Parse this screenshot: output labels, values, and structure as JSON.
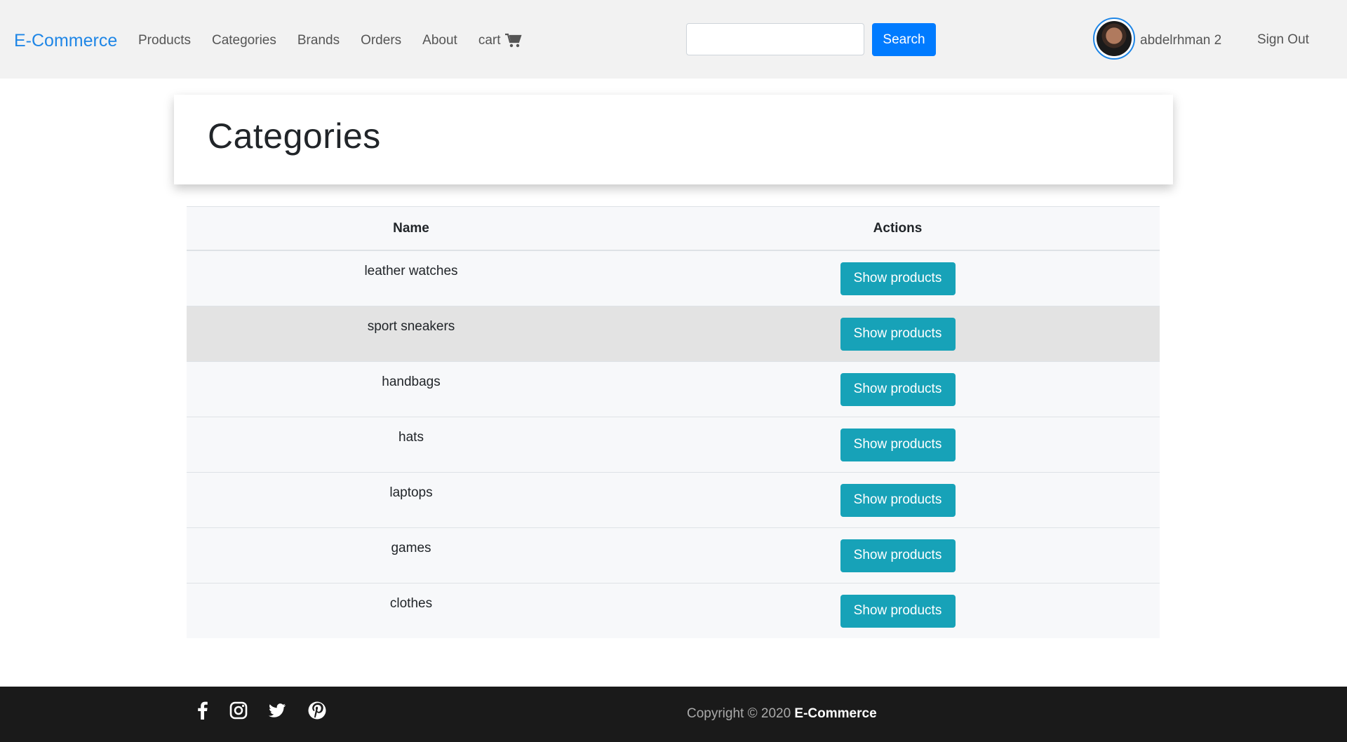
{
  "navbar": {
    "brand": "E-Commerce",
    "links": [
      "Products",
      "Categories",
      "Brands",
      "Orders",
      "About",
      "cart"
    ],
    "search_placeholder": "",
    "search_label": "Search",
    "username": "abdelrhman 2",
    "signout_label": "Sign Out"
  },
  "page": {
    "title": "Categories"
  },
  "table": {
    "headers": [
      "Name",
      "Actions"
    ],
    "button_label": "Show products",
    "rows": [
      "leather watches",
      "sport sneakers",
      "handbags",
      "hats",
      "laptops",
      "games",
      "clothes"
    ]
  },
  "footer": {
    "copyright_prefix": "Copyright © 2020",
    "copyright_brand": "E-Commerce"
  },
  "icons": [
    "cart-icon",
    "facebook-icon",
    "instagram-icon",
    "twitter-icon",
    "pinterest-icon"
  ],
  "colors": {
    "brand": "#1f86e6",
    "primary": "#007bff",
    "info": "#17a2b8",
    "footer_bg": "#1a1a1a"
  }
}
